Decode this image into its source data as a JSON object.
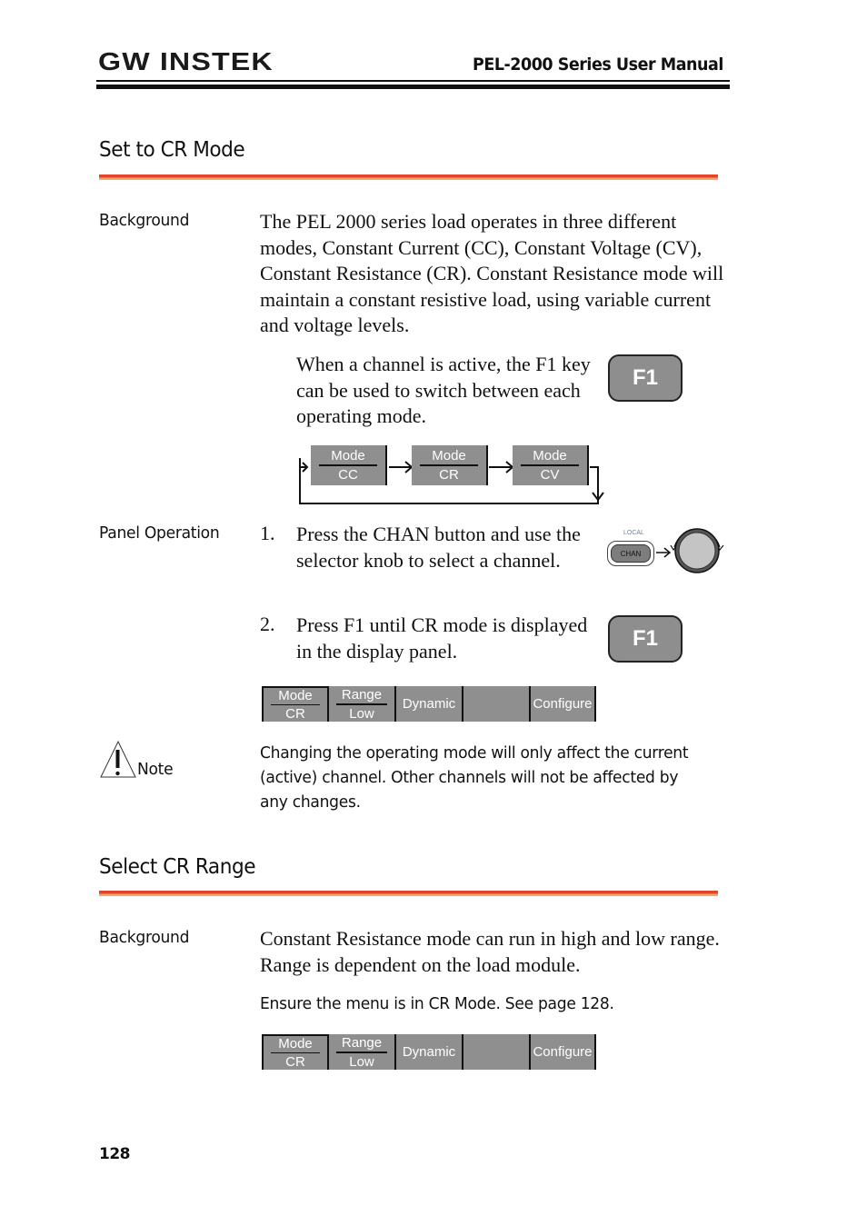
{
  "header": {
    "logo": "GW INSTEK",
    "manual_title": "PEL-2000 Series User Manual"
  },
  "section1": {
    "title": "Set to CR Mode",
    "background_label": "Background",
    "background_text": "The PEL 2000 series load operates in three different modes, Constant Current (CC), Constant Voltage (CV), Constant Resistance (CR). Constant Resistance mode will maintain a constant resistive load, using variable current and voltage levels.",
    "f1_note": "When a channel is active, the F1 key can be used to switch between each operating mode.",
    "f1_key_label": "F1",
    "mode_cycle": [
      {
        "top": "Mode",
        "bottom": "CC"
      },
      {
        "top": "Mode",
        "bottom": "CR"
      },
      {
        "top": "Mode",
        "bottom": "CV"
      }
    ],
    "panel_operation_label": "Panel Operation",
    "steps": [
      {
        "num": "1.",
        "text": "Press the CHAN button and use the selector knob to select a channel."
      },
      {
        "num": "2.",
        "text": "Press F1 until CR mode is displayed in the display panel."
      }
    ],
    "chan_button": {
      "local_label": "LOCAL",
      "label": "CHAN"
    },
    "softkeys": [
      {
        "top": "Mode",
        "bottom": "CR"
      },
      {
        "top": "Range",
        "bottom": "Low"
      },
      {
        "label": "Dynamic"
      },
      {
        "label": ""
      },
      {
        "label": "Configure"
      }
    ],
    "note_label": "Note",
    "note_text": "Changing the operating mode will only affect the current (active) channel. Other channels will not be affected by any changes."
  },
  "section2": {
    "title": "Select CR Range",
    "background_label": "Background",
    "background_text": "Constant Resistance mode can run in high and low range. Range is dependent on the load module.",
    "ensure_text": "Ensure the menu is in CR Mode. See page 128.",
    "softkeys": [
      {
        "top": "Mode",
        "bottom": "CR"
      },
      {
        "top": "Range",
        "bottom": "Low"
      },
      {
        "label": "Dynamic"
      },
      {
        "label": ""
      },
      {
        "label": "Configure"
      }
    ]
  },
  "footer": {
    "page_number": "128"
  }
}
